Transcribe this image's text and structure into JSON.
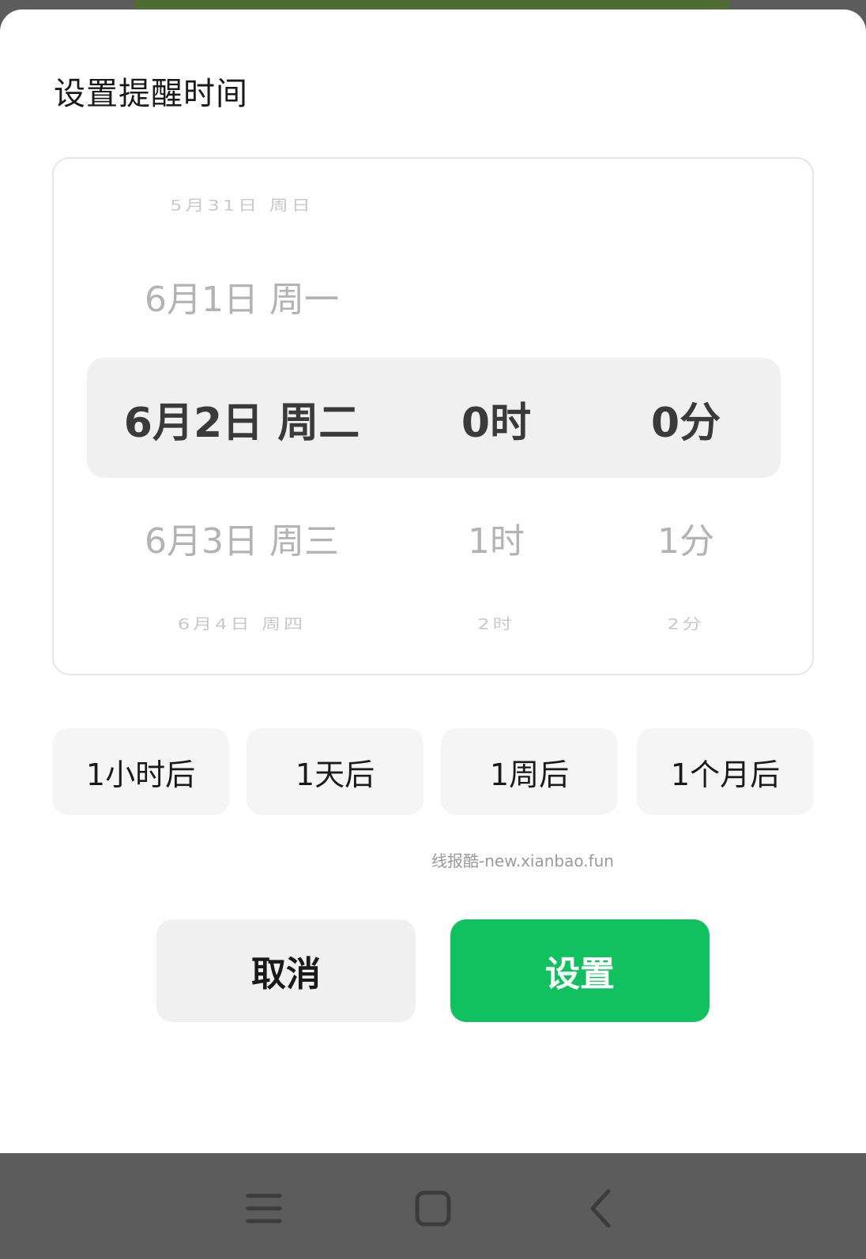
{
  "dialog": {
    "title": "设置提醒时间"
  },
  "picker": {
    "date": {
      "far_top": "5月31日 周日",
      "near_top": "6月1日 周一",
      "selected": "6月2日 周二",
      "near_bottom": "6月3日 周三",
      "far_bottom": "6月4日 周四"
    },
    "hour": {
      "far_top": "",
      "near_top": "",
      "selected": "0时",
      "near_bottom": "1时",
      "far_bottom": "2时"
    },
    "minute": {
      "far_top": "",
      "near_top": "",
      "selected": "0分",
      "near_bottom": "1分",
      "far_bottom": "2分"
    }
  },
  "quick_options": [
    {
      "label": "1小时后"
    },
    {
      "label": "1天后"
    },
    {
      "label": "1周后"
    },
    {
      "label": "1个月后"
    }
  ],
  "watermark": "线报酷-new.xianbao.fun",
  "actions": {
    "cancel_label": "取消",
    "confirm_label": "设置"
  },
  "colors": {
    "accent": "#11c15f",
    "nav_bar": "#5c5c5c"
  },
  "navigation": {
    "icons": [
      "menu-icon",
      "home-icon",
      "back-icon"
    ]
  }
}
